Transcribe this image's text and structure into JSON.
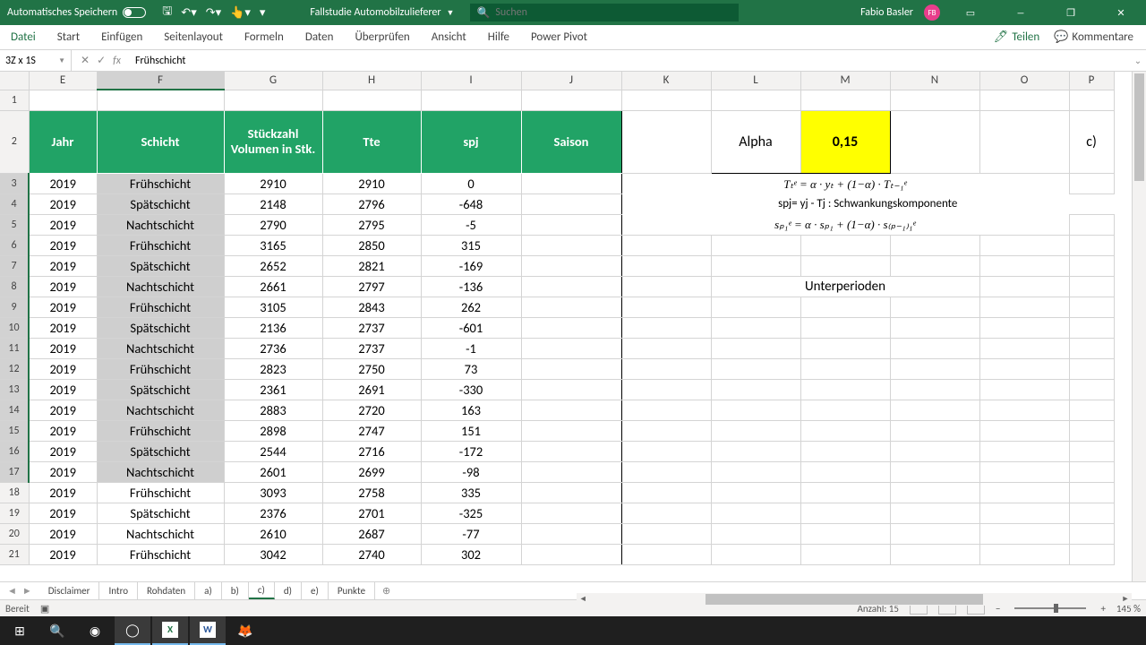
{
  "titlebar": {
    "autosave_label": "Automatisches Speichern",
    "doc_name": "Fallstudie Automobilzulieferer",
    "search_placeholder": "Suchen",
    "user_name": "Fabio Basler",
    "user_initials": "FB"
  },
  "ribbon": {
    "tabs": [
      "Datei",
      "Start",
      "Einfügen",
      "Seitenlayout",
      "Formeln",
      "Daten",
      "Überprüfen",
      "Ansicht",
      "Hilfe",
      "Power Pivot"
    ],
    "share": "Teilen",
    "comments": "Kommentare"
  },
  "formula_bar": {
    "name_box": "3Z x 1S",
    "formula": "Frühschicht"
  },
  "columns": [
    "E",
    "F",
    "G",
    "H",
    "I",
    "J",
    "K",
    "L",
    "M",
    "N",
    "O",
    "P"
  ],
  "headers": {
    "E": "Jahr",
    "F": "Schicht",
    "G": "Stückzahl Volumen in Stk.",
    "H": "Tte",
    "I": "spj",
    "J": "Saison"
  },
  "alpha_label": "Alpha",
  "alpha_value": "0,15",
  "formula1": "Tₜᵉ = α · yₜ + (1−α) · Tₜ₋₁ᵉ",
  "formula2": "spj= yj - Tj : Schwankungskomponente",
  "formula3": "sₚ₁ᵉ = α · sₚ₁ + (1−α) · s₍ₚ₋₁₎₁ᵉ",
  "unterperioden": "Unterperioden",
  "side_c": "c)",
  "rows": [
    {
      "r": 3,
      "E": "2019",
      "F": "Frühschicht",
      "G": "2910",
      "H": "2910",
      "I": "0",
      "sel": true
    },
    {
      "r": 4,
      "E": "2019",
      "F": "Spätschicht",
      "G": "2148",
      "H": "2796",
      "I": "-648",
      "sel": true
    },
    {
      "r": 5,
      "E": "2019",
      "F": "Nachtschicht",
      "G": "2790",
      "H": "2795",
      "I": "-5",
      "sel": true
    },
    {
      "r": 6,
      "E": "2019",
      "F": "Frühschicht",
      "G": "3165",
      "H": "2850",
      "I": "315",
      "sel": true
    },
    {
      "r": 7,
      "E": "2019",
      "F": "Spätschicht",
      "G": "2652",
      "H": "2821",
      "I": "-169",
      "sel": true
    },
    {
      "r": 8,
      "E": "2019",
      "F": "Nachtschicht",
      "G": "2661",
      "H": "2797",
      "I": "-136",
      "sel": true
    },
    {
      "r": 9,
      "E": "2019",
      "F": "Frühschicht",
      "G": "3105",
      "H": "2843",
      "I": "262",
      "sel": true
    },
    {
      "r": 10,
      "E": "2019",
      "F": "Spätschicht",
      "G": "2136",
      "H": "2737",
      "I": "-601",
      "sel": true
    },
    {
      "r": 11,
      "E": "2019",
      "F": "Nachtschicht",
      "G": "2736",
      "H": "2737",
      "I": "-1",
      "sel": true
    },
    {
      "r": 12,
      "E": "2019",
      "F": "Frühschicht",
      "G": "2823",
      "H": "2750",
      "I": "73",
      "sel": true
    },
    {
      "r": 13,
      "E": "2019",
      "F": "Spätschicht",
      "G": "2361",
      "H": "2691",
      "I": "-330",
      "sel": true
    },
    {
      "r": 14,
      "E": "2019",
      "F": "Nachtschicht",
      "G": "2883",
      "H": "2720",
      "I": "163",
      "sel": true
    },
    {
      "r": 15,
      "E": "2019",
      "F": "Frühschicht",
      "G": "2898",
      "H": "2747",
      "I": "151",
      "sel": true
    },
    {
      "r": 16,
      "E": "2019",
      "F": "Spätschicht",
      "G": "2544",
      "H": "2716",
      "I": "-172",
      "sel": true
    },
    {
      "r": 17,
      "E": "2019",
      "F": "Nachtschicht",
      "G": "2601",
      "H": "2699",
      "I": "-98",
      "sel": true
    },
    {
      "r": 18,
      "E": "2019",
      "F": "Frühschicht",
      "G": "3093",
      "H": "2758",
      "I": "335"
    },
    {
      "r": 19,
      "E": "2019",
      "F": "Spätschicht",
      "G": "2376",
      "H": "2701",
      "I": "-325"
    },
    {
      "r": 20,
      "E": "2019",
      "F": "Nachtschicht",
      "G": "2610",
      "H": "2687",
      "I": "-77"
    },
    {
      "r": 21,
      "E": "2019",
      "F": "Frühschicht",
      "G": "3042",
      "H": "2740",
      "I": "302"
    }
  ],
  "sheet_tabs": [
    "Disclaimer",
    "Intro",
    "Rohdaten",
    "a)",
    "b)",
    "c)",
    "d)",
    "e)",
    "Punkte"
  ],
  "active_sheet": "c)",
  "status": {
    "ready": "Bereit",
    "count": "Anzahl: 15",
    "zoom": "145 %"
  }
}
